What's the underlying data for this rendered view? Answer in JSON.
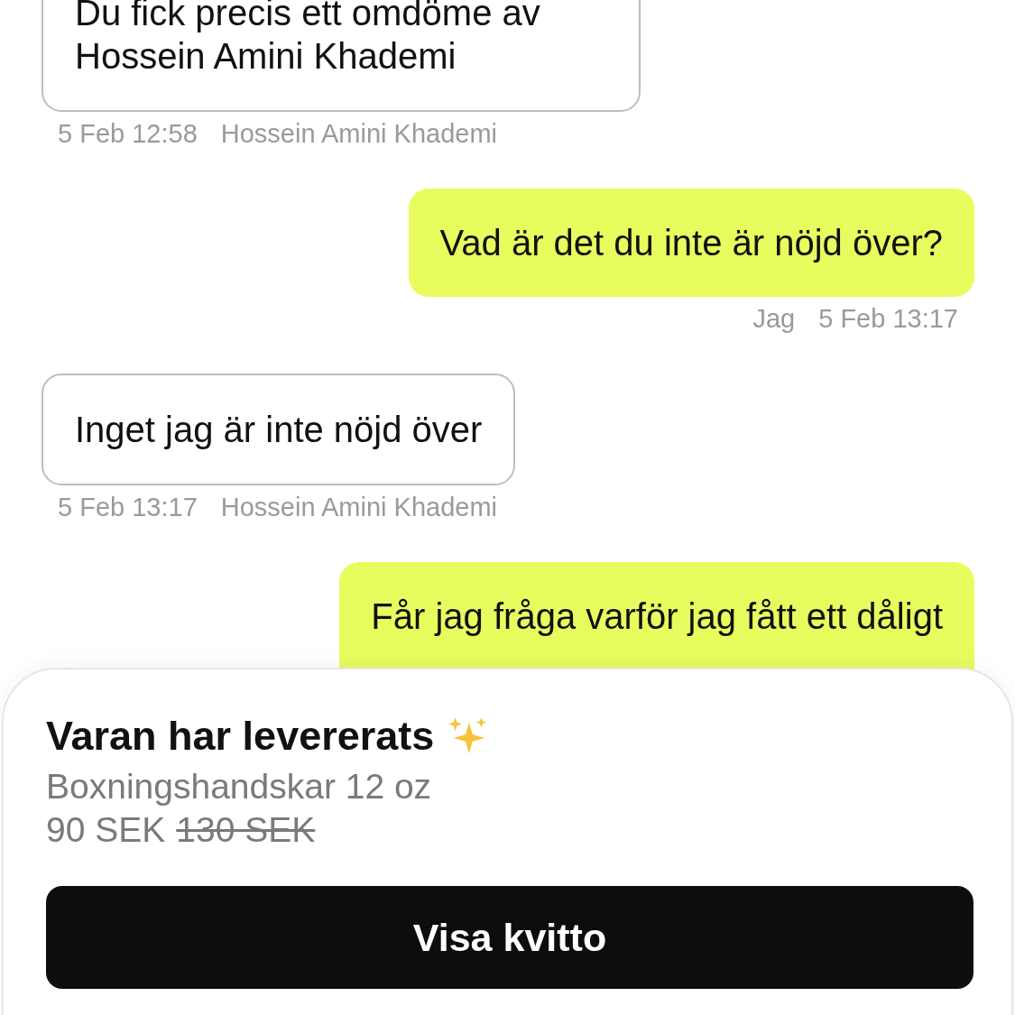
{
  "messages": [
    {
      "kind": "received",
      "text": "Du fick precis ett omdöme av Hossein Amini Khademi",
      "time": "5 Feb 12:58",
      "sender": "Hossein Amini Khademi"
    },
    {
      "kind": "sent",
      "text": "Vad är det du inte är nöjd över?",
      "time": "5 Feb 13:17",
      "sender": "Jag"
    },
    {
      "kind": "received",
      "text": "Inget jag är inte nöjd över",
      "time": "5 Feb 13:17",
      "sender": "Hossein Amini Khademi"
    },
    {
      "kind": "sent",
      "text": "Får jag fråga varför jag fått ett dåligt"
    }
  ],
  "order_sheet": {
    "title": "Varan har levererats",
    "product": "Boxningshandskar 12 oz",
    "price": "90 SEK",
    "old_price": "130 SEK",
    "button": "Visa kvitto"
  }
}
